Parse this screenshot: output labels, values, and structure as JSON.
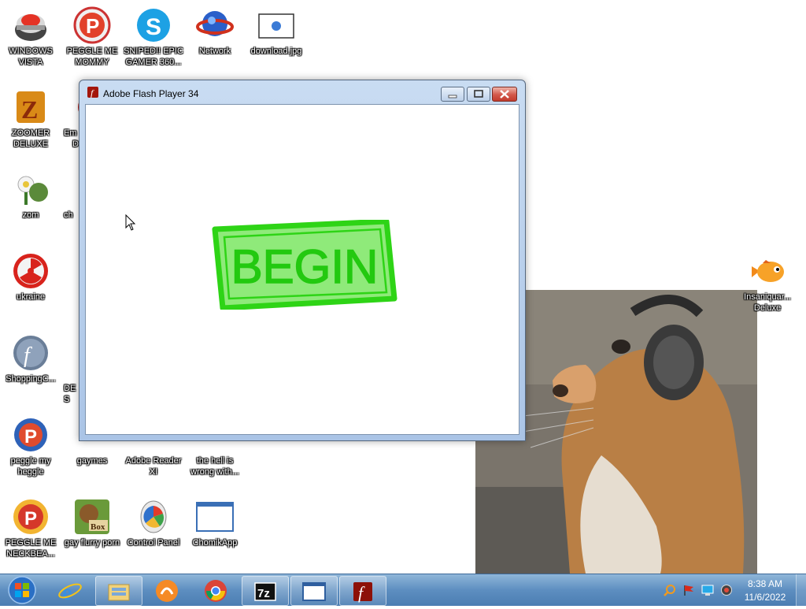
{
  "desktop": {
    "icons": {
      "windows_vista": "WINDOWS VISTA",
      "peggle_me_mommy": "PEGGLE ME MOMMY",
      "sniped": "SNIPED!! EPIC GAMER 360...",
      "network": "Network",
      "download_jpg": "download.jpg",
      "zoomer_deluxe": "ZOOMER DELUXE",
      "zom": "zom",
      "ukraine": "ukraine",
      "shopping": "ShoppingC...",
      "peggle_my_heggle": "peggle my heggle",
      "gaymes": "gaymes",
      "adobe_reader": "Adobe Reader XI",
      "hell_wrong": "the hell is wrong with...",
      "peggle_neckbeard": "PEGGLE ME NECKBEA...",
      "gay_flurry_porn": "gay flurry porn",
      "control_panel": "Control Panel",
      "chomikapp": "ChomikApp",
      "insaniquarium": "Insaniquar... Deluxe"
    },
    "partial_labels": {
      "em_label": "Em",
      "d_label": "D",
      "ch_label": "ch",
      "des_label": "DES"
    }
  },
  "window": {
    "title": "Adobe Flash Player 34",
    "begin_text": "BEGIN"
  },
  "taskbar": {
    "time": "8:38 AM",
    "date": "11/6/2022"
  },
  "colors": {
    "taskbar": "#5d8ec0",
    "begin_fill": "#8fea7a",
    "begin_stroke": "#2ed416"
  }
}
